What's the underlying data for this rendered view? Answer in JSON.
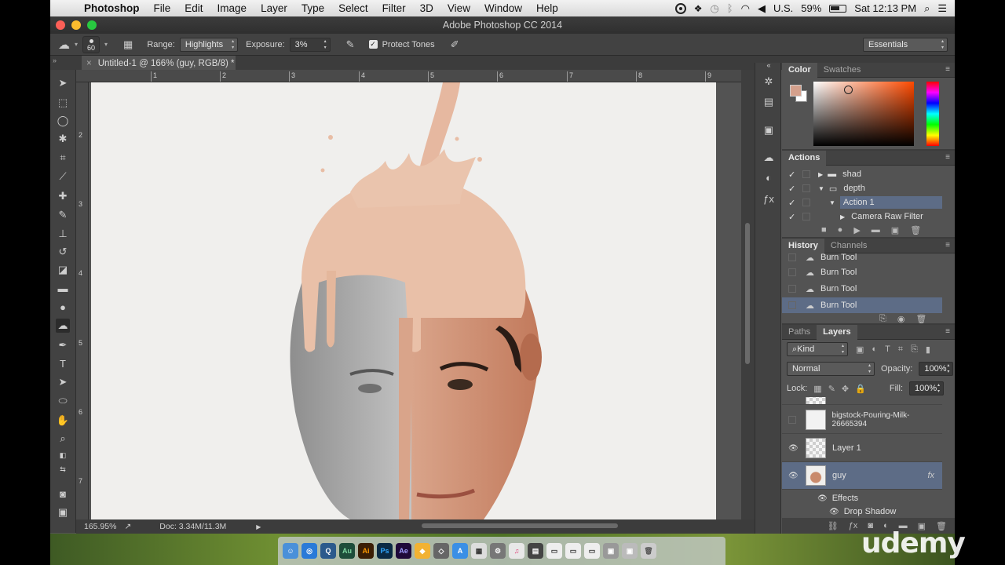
{
  "menubar": {
    "app_name": "Photoshop",
    "items": [
      "File",
      "Edit",
      "Image",
      "Layer",
      "Type",
      "Select",
      "Filter",
      "3D",
      "View",
      "Window",
      "Help"
    ],
    "input_source": "U.S.",
    "battery": "59%",
    "clock": "Sat 12:13 PM"
  },
  "window": {
    "title": "Adobe Photoshop CC 2014"
  },
  "options_bar": {
    "brush_size": "60",
    "range_label": "Range:",
    "range_value": "Highlights",
    "exposure_label": "Exposure:",
    "exposure_value": "3%",
    "protect_tones_label": "Protect Tones",
    "workspace": "Essentials"
  },
  "document": {
    "tab_title": "Untitled-1 @ 166% (guy, RGB/8) *",
    "ruler_top_ticks": [
      "1",
      "2",
      "3",
      "4",
      "5",
      "6",
      "7",
      "8",
      "9"
    ],
    "ruler_left_ticks": [
      "2",
      "3",
      "4",
      "5",
      "6",
      "7"
    ]
  },
  "status_bar": {
    "zoom": "165.95%",
    "doc_size": "Doc: 3.34M/11.3M"
  },
  "color_panel": {
    "tabs": [
      "Color",
      "Swatches"
    ],
    "fg_color": "#d4a08c",
    "bg_color": "#ffffff"
  },
  "actions_panel": {
    "title": "Actions",
    "items": [
      {
        "label": "shad",
        "level": 1,
        "expanded": false
      },
      {
        "label": "depth",
        "level": 1,
        "expanded": true
      },
      {
        "label": "Action 1",
        "level": 2,
        "expanded": true
      },
      {
        "label": "Camera Raw Filter",
        "level": 3,
        "expanded": false
      }
    ]
  },
  "history_panel": {
    "tabs": [
      "History",
      "Channels"
    ],
    "items": [
      "Burn Tool",
      "Burn Tool",
      "Burn Tool",
      "Burn Tool"
    ]
  },
  "layers_panel": {
    "tabs": [
      "Paths",
      "Layers"
    ],
    "filter_kind": "Kind",
    "blend_mode": "Normal",
    "opacity_label": "Opacity:",
    "opacity_value": "100%",
    "lock_label": "Lock:",
    "fill_label": "Fill:",
    "fill_value": "100%",
    "layers": [
      {
        "name": "bigstock-Pouring-Milk-26665394",
        "visible": false
      },
      {
        "name": "Layer 1",
        "visible": true
      },
      {
        "name": "guy",
        "visible": true,
        "selected": true,
        "fx": "fx"
      }
    ],
    "effects_label": "Effects",
    "effect_items": [
      "Drop Shadow"
    ]
  },
  "watermark": {
    "brand": "udemy"
  }
}
